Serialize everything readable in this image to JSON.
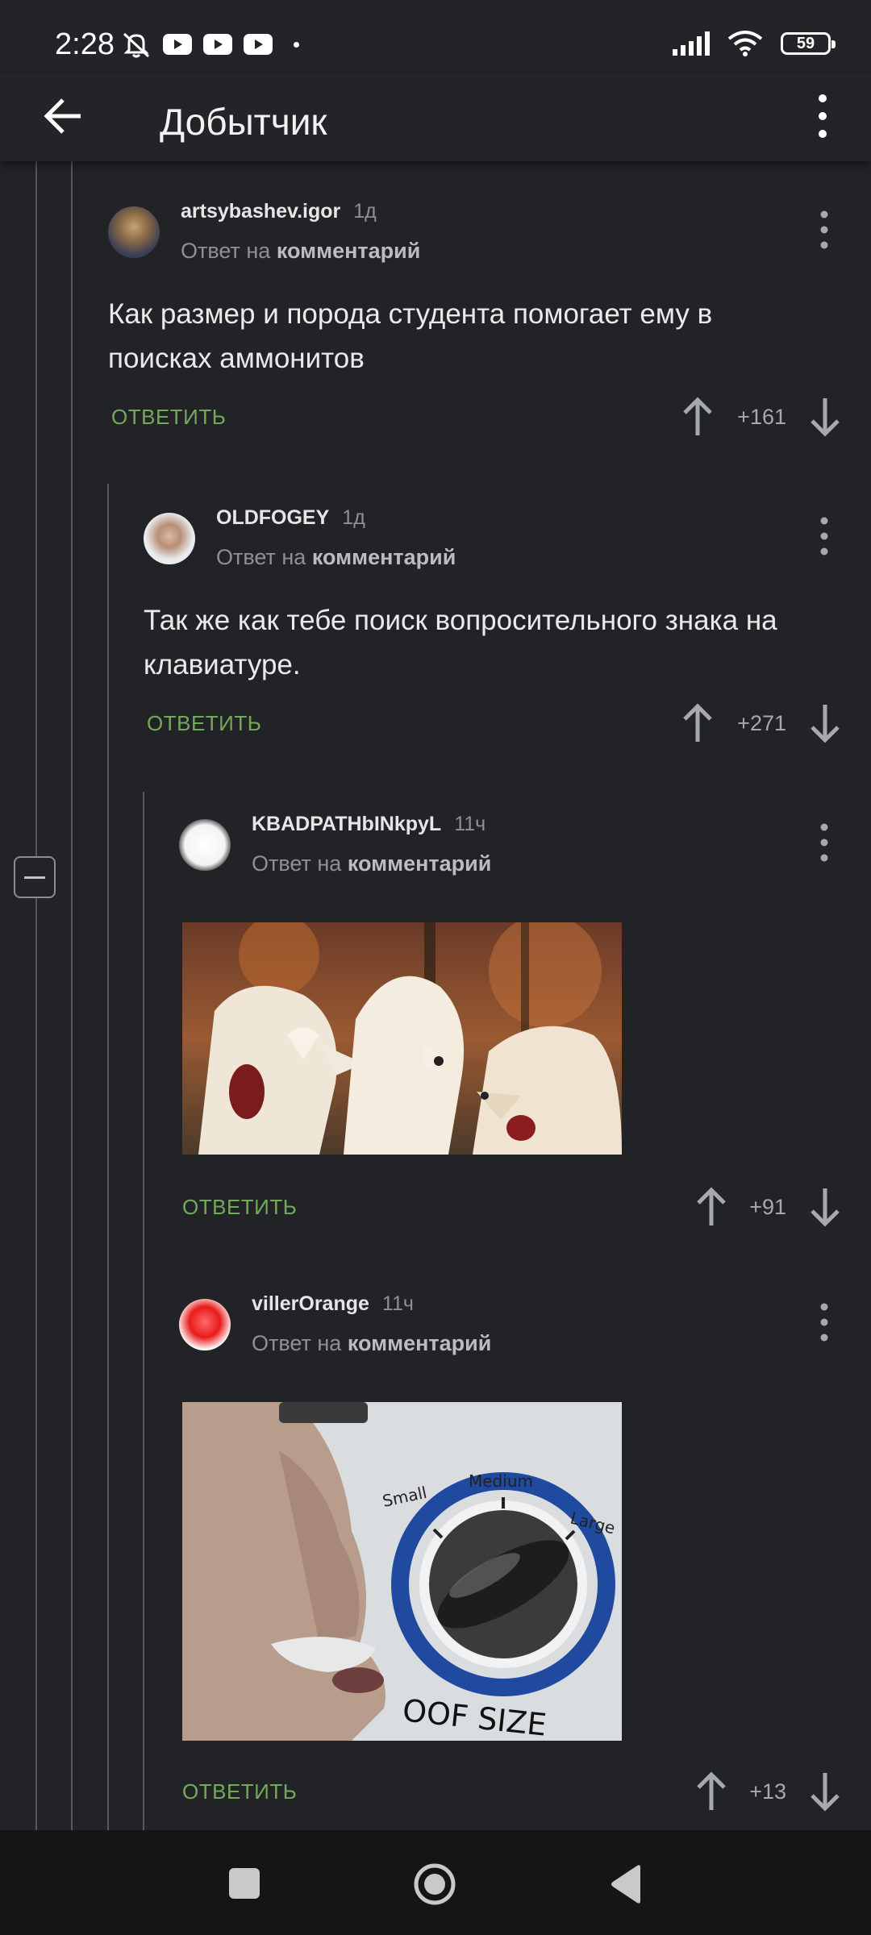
{
  "status_bar": {
    "time": "2:28",
    "battery": "59"
  },
  "app_bar": {
    "title": "Добытчик"
  },
  "comments": [
    {
      "user": "artsybashev.igor",
      "time": "1д",
      "reply_prefix": "Ответ на",
      "reply_target": "комментарий",
      "text": "Как размер и порода студента помогает ему в поисках аммонитов",
      "reply_label": "ОТВЕТИТЬ",
      "score": "+161"
    },
    {
      "user": "OLDFOGEY",
      "time": "1д",
      "reply_prefix": "Ответ на",
      "reply_target": "комментарий",
      "text": "Так же как тебе поиск вопросительного знака на клавиатуре.",
      "reply_label": "ОТВЕТИТЬ",
      "score": "+271"
    },
    {
      "user": "KBADPATHbINkpyL",
      "time": "11ч",
      "reply_prefix": "Ответ на",
      "reply_target": "комментарий",
      "reply_label": "ОТВЕТИТЬ",
      "score": "+91"
    },
    {
      "user": "villerOrange",
      "time": "11ч",
      "reply_prefix": "Ответ на",
      "reply_target": "комментарий",
      "reply_label": "ОТВЕТИТЬ",
      "score": "+13",
      "meme": {
        "small": "Small",
        "medium": "Medium",
        "large": "Large",
        "caption": "OOF SIZE"
      }
    }
  ]
}
